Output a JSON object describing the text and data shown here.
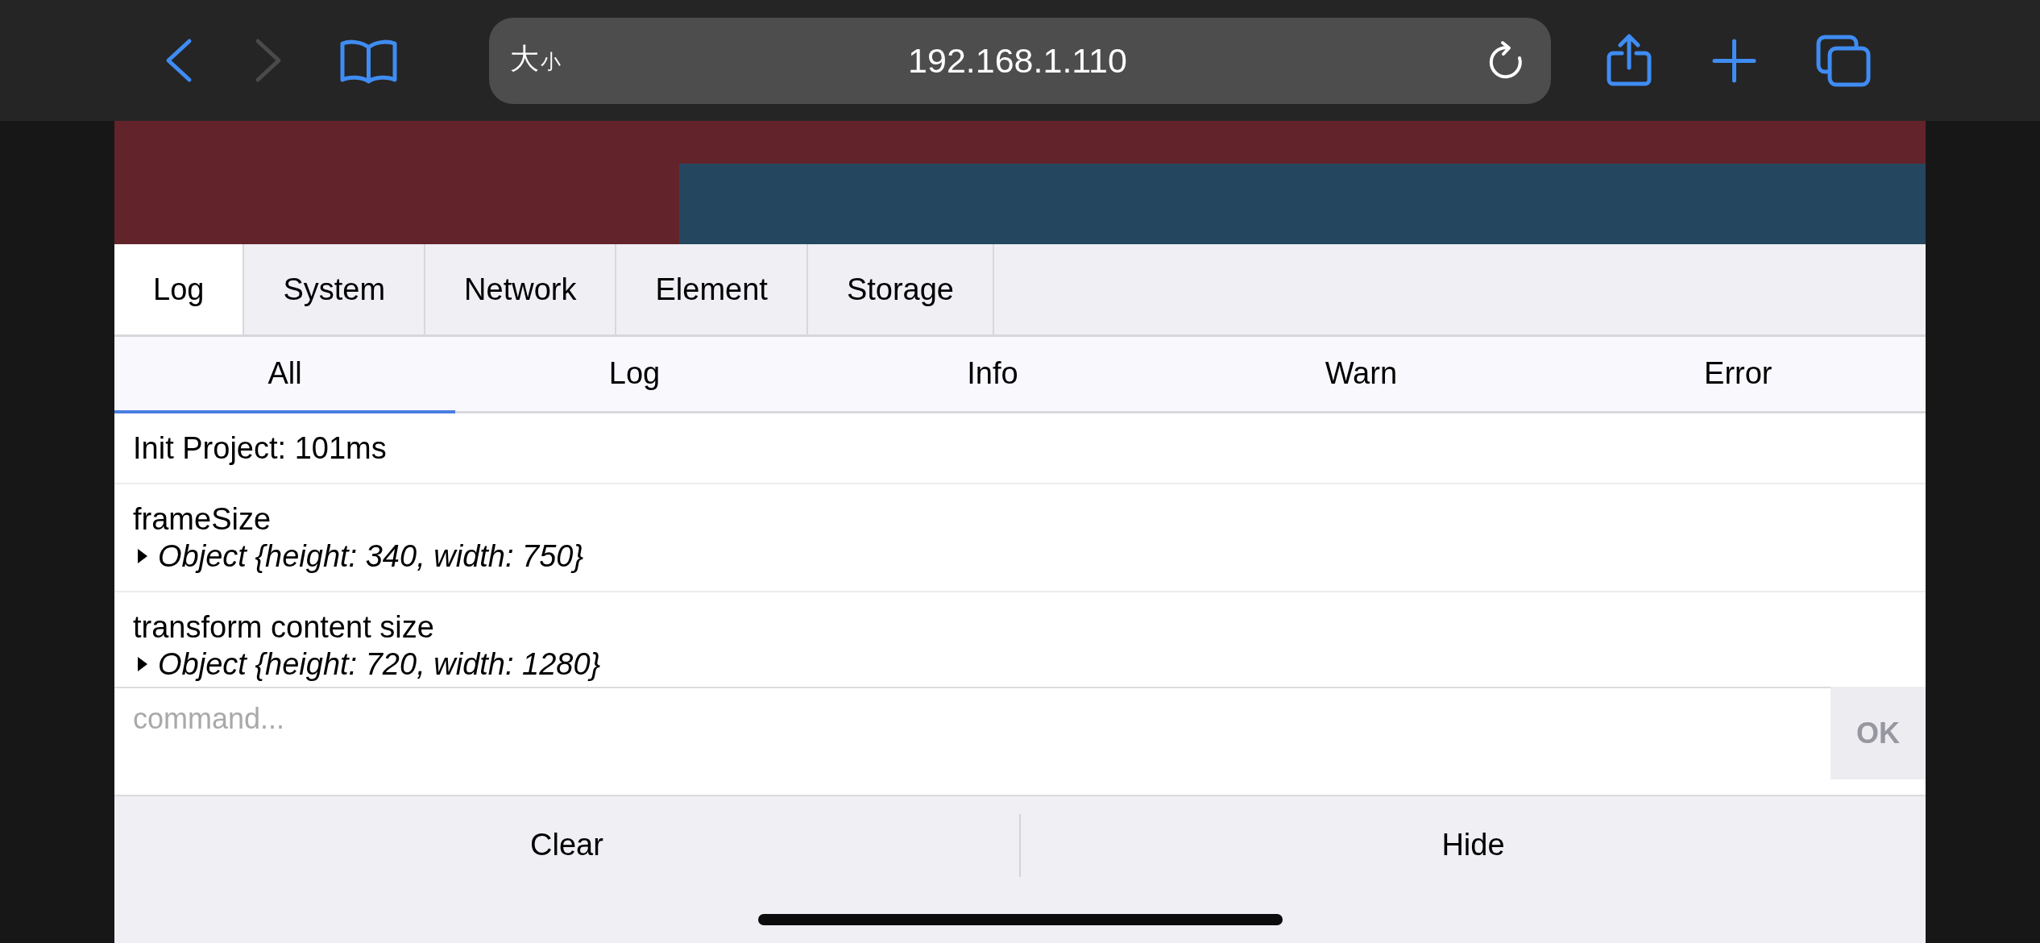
{
  "browser": {
    "text_size_label": "大小",
    "url": "192.168.1.110",
    "back_disabled": false,
    "forward_disabled": true
  },
  "tabs": [
    {
      "label": "Log",
      "selected": true
    },
    {
      "label": "System",
      "selected": false
    },
    {
      "label": "Network",
      "selected": false
    },
    {
      "label": "Element",
      "selected": false
    },
    {
      "label": "Storage",
      "selected": false
    }
  ],
  "filters": [
    {
      "label": "All",
      "selected": true
    },
    {
      "label": "Log",
      "selected": false
    },
    {
      "label": "Info",
      "selected": false
    },
    {
      "label": "Warn",
      "selected": false
    },
    {
      "label": "Error",
      "selected": false
    }
  ],
  "log_rows": [
    {
      "message": "Init Project: 101ms"
    },
    {
      "message": "frameSize",
      "object": "Object {height: 340, width: 750}",
      "expanded": false
    },
    {
      "message": "transform content size",
      "object": "Object {height: 720, width: 1280}",
      "expanded": false
    }
  ],
  "command": {
    "placeholder": "command...",
    "button": "OK"
  },
  "footer_buttons": [
    "Clear",
    "Hide"
  ]
}
